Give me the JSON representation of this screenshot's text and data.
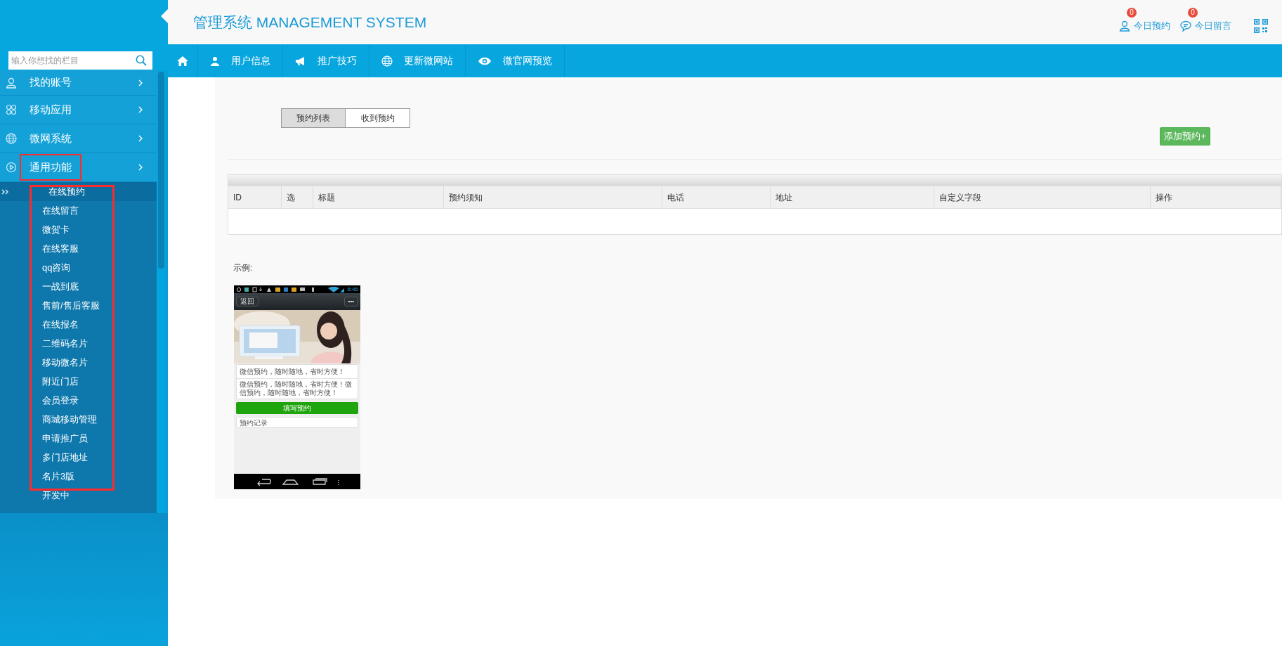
{
  "header": {
    "title": "管理系统 MANAGEMENT SYSTEM",
    "links": [
      {
        "kind": "user",
        "label": "今日预约",
        "badge": "0"
      },
      {
        "kind": "chat",
        "label": "今日留言",
        "badge": "0"
      }
    ]
  },
  "sidebar": {
    "search": {
      "placeholder": "输入你想找的栏目"
    },
    "items": [
      {
        "kind": "user",
        "label": "找的账号",
        "highlighted": false
      },
      {
        "kind": "apps",
        "label": "移动应用",
        "highlighted": false
      },
      {
        "kind": "globe",
        "label": "微网系统",
        "highlighted": false
      },
      {
        "kind": "play",
        "label": "通用功能",
        "highlighted": true,
        "submenu_highlighted": true,
        "children": [
          {
            "label": "在线预约",
            "selected": true
          },
          {
            "label": "在线留言",
            "selected": false
          },
          {
            "label": "微贺卡",
            "selected": false
          },
          {
            "label": "在线客服",
            "selected": false
          },
          {
            "label": "qq咨询",
            "selected": false
          },
          {
            "label": "一战到底",
            "selected": false
          },
          {
            "label": "售前/售后客服",
            "selected": false
          },
          {
            "label": "在线报名",
            "selected": false
          },
          {
            "label": "二维码名片",
            "selected": false
          },
          {
            "label": "移动微名片",
            "selected": false
          },
          {
            "label": "附近门店",
            "selected": false
          },
          {
            "label": "会员登录",
            "selected": false
          },
          {
            "label": "商城移动管理",
            "selected": false
          },
          {
            "label": "申请推广员",
            "selected": false
          },
          {
            "label": "多门店地址",
            "selected": false
          },
          {
            "label": "名片3版",
            "selected": false
          },
          {
            "label": "开发中",
            "selected": false
          }
        ]
      }
    ]
  },
  "nav": [
    {
      "kind": "home"
    },
    {
      "kind": "user",
      "label": "用户信息"
    },
    {
      "kind": "megaphone",
      "label": "推广技巧"
    },
    {
      "kind": "globe",
      "label": "更新微网站"
    },
    {
      "kind": "eye",
      "label": "微官网预览"
    }
  ],
  "tabs": [
    {
      "label": "预约列表",
      "selected": true
    },
    {
      "label": "收到预约",
      "selected": false
    }
  ],
  "add_button": "添加预约+",
  "table": {
    "columns": [
      "ID",
      "选",
      "标题",
      "预约须知",
      "电话",
      "地址",
      "自定义字段",
      "操作"
    ]
  },
  "example": {
    "label": "示例:",
    "phone": {
      "time": "6:46",
      "back": "返回",
      "more": "•••",
      "headline": "微信预约，随时随地，省时方便！",
      "description": "微信预约，随时随地，省时方便！微信预约，随时随地，省时方便！",
      "button": "填写预约",
      "record": "预约记录"
    }
  }
}
